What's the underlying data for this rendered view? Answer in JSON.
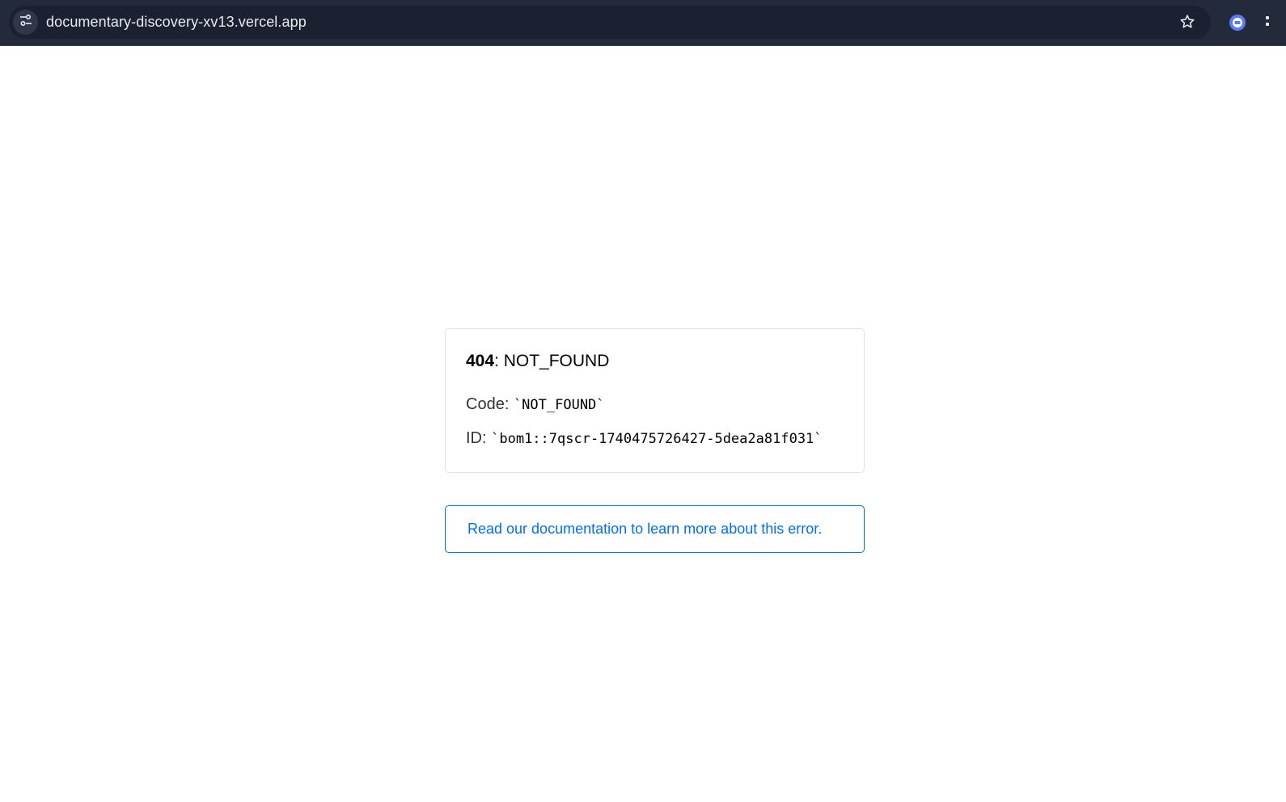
{
  "browser": {
    "url": "documentary-discovery-xv13.vercel.app",
    "icons": {
      "site_info": "tune-icon",
      "bookmark": "star-icon",
      "extension": "extension-icon",
      "menu": "menu-icon"
    }
  },
  "error": {
    "status_code": "404",
    "status_separator": ": NOT_FOUND",
    "code_label": "Code: ",
    "code_value": "`NOT_FOUND`",
    "id_label": "ID: ",
    "id_value": "`bom1::7qscr-1740475726427-5dea2a81f031`"
  },
  "docs": {
    "link_text": "Read our documentation to learn more about this error."
  },
  "colors": {
    "link": "#0070f3",
    "toolbar": "#232a3a"
  }
}
